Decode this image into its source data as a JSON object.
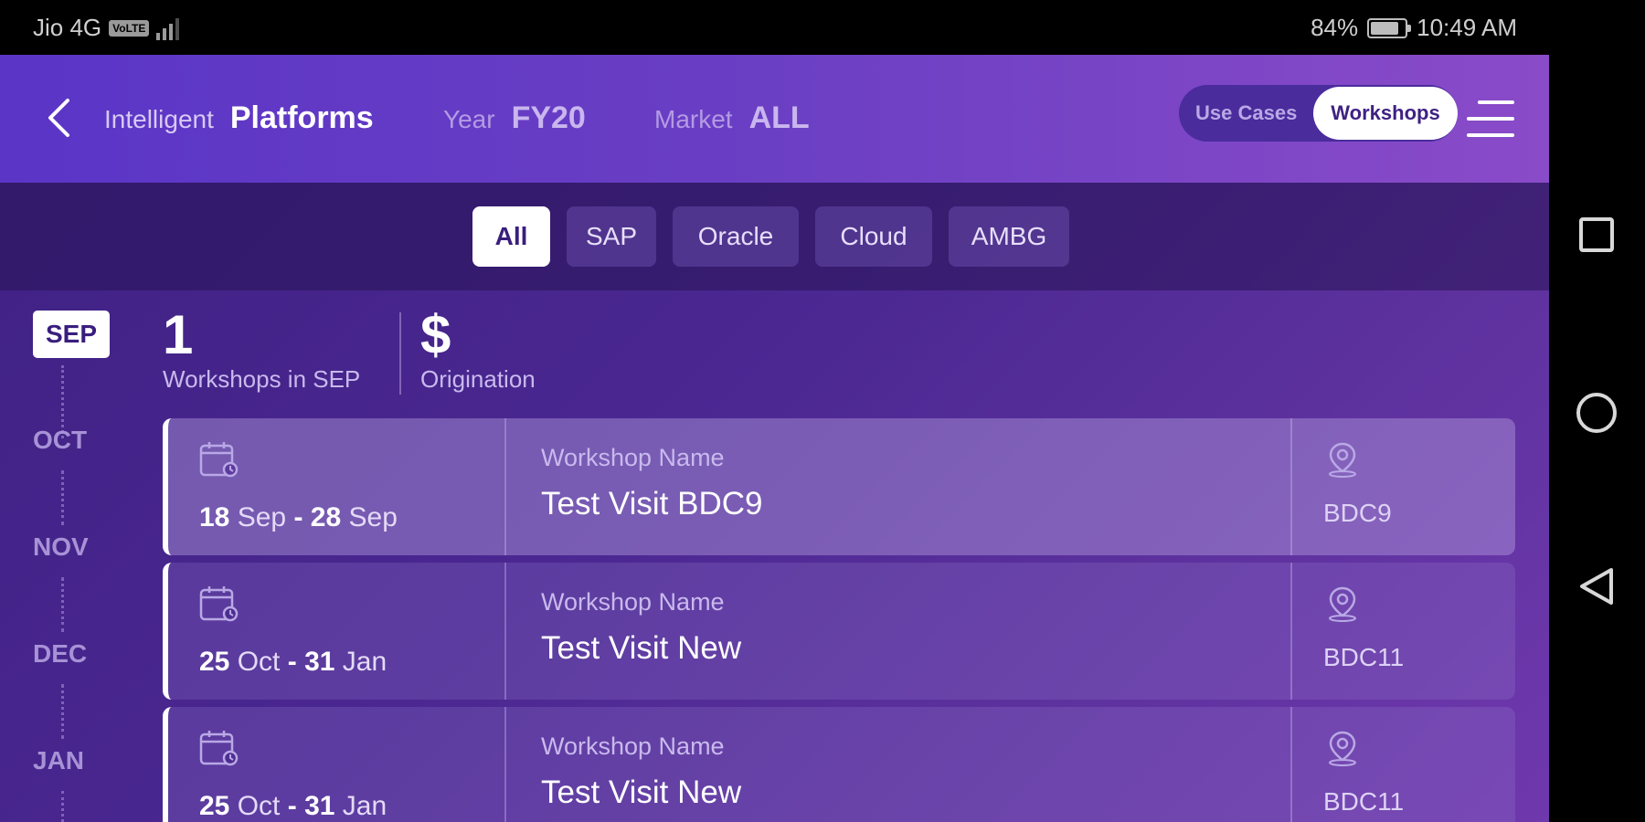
{
  "status_bar": {
    "carrier": "Jio 4G",
    "volte": "VoLTE",
    "network": "4G",
    "battery_percent": "84%",
    "battery_level": 0.84,
    "time": "10:49 AM"
  },
  "header": {
    "back_icon": "chevron-left-icon",
    "intelligent_label": "Intelligent",
    "platforms_label": "Platforms",
    "year_label": "Year",
    "year_value": "FY20",
    "market_label": "Market",
    "market_value": "ALL",
    "toggle": {
      "use_cases": "Use Cases",
      "workshops": "Workshops",
      "active": "Workshops"
    },
    "menu_icon": "hamburger-icon"
  },
  "filters": {
    "active": "All",
    "chips": [
      "All",
      "SAP",
      "Oracle",
      "Cloud",
      "AMBG"
    ]
  },
  "months": {
    "selected": "SEP",
    "items": [
      "OCT",
      "NOV",
      "DEC",
      "JAN"
    ]
  },
  "stats": {
    "count": "1",
    "count_label": "Workshops in SEP",
    "origination_value": "$",
    "origination_label": "Origination"
  },
  "workshops": [
    {
      "start_day": "18",
      "start_month": "Sep",
      "end_day": "28",
      "end_month": "Sep",
      "name_label": "Workshop Name",
      "name": "Test Visit BDC9",
      "location": "BDC9"
    },
    {
      "start_day": "25",
      "start_month": "Oct",
      "end_day": "31",
      "end_month": "Jan",
      "name_label": "Workshop Name",
      "name": "Test Visit New",
      "location": "BDC11"
    },
    {
      "start_day": "25",
      "start_month": "Oct",
      "end_day": "31",
      "end_month": "Jan",
      "name_label": "Workshop Name",
      "name": "Test Visit New",
      "location": "BDC11"
    }
  ],
  "colors": {
    "accent": "#5a35c6",
    "background": "#4a2791",
    "chip_active": "#ffffff"
  }
}
